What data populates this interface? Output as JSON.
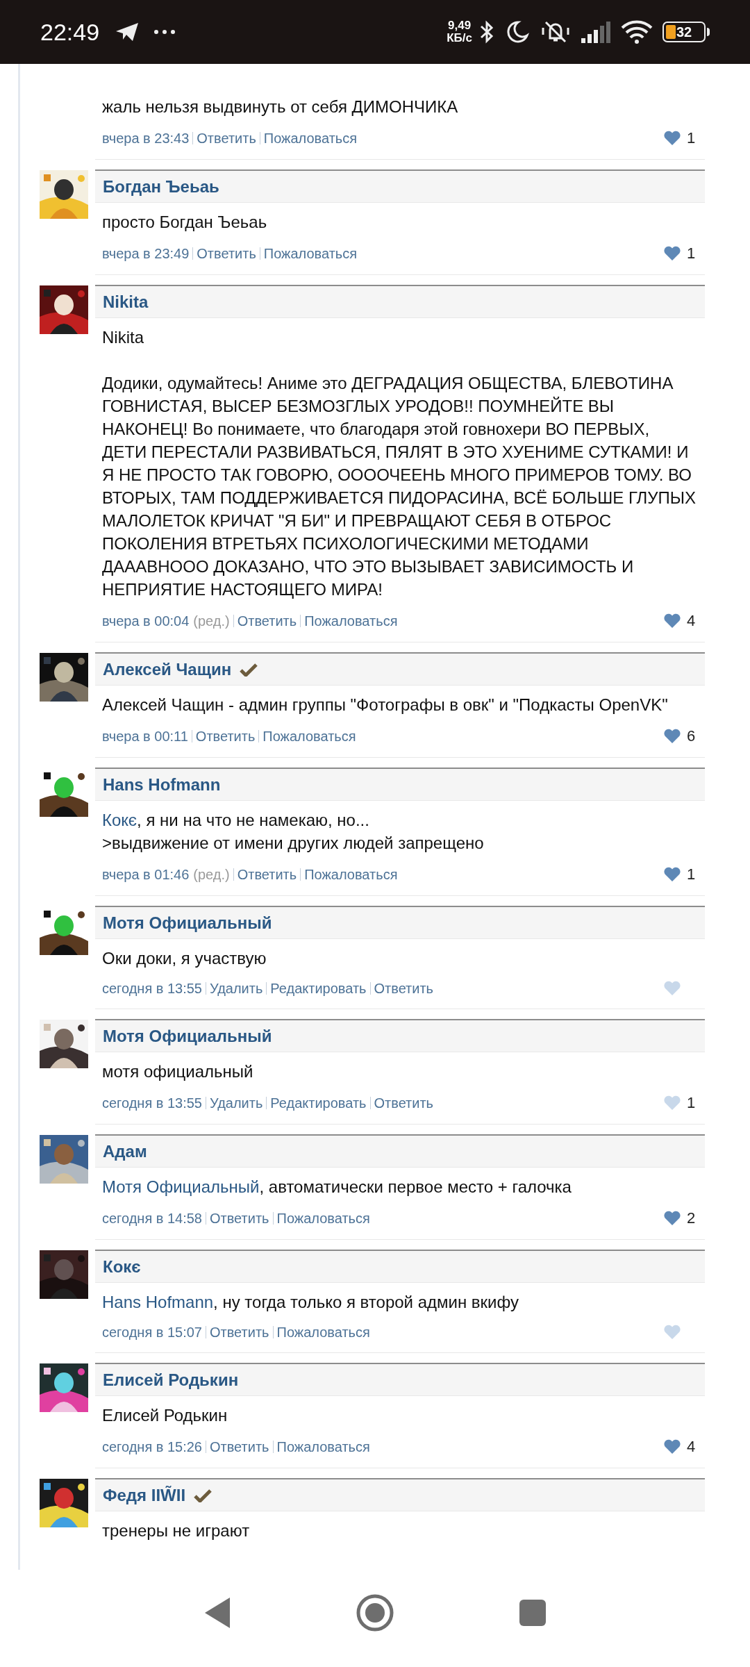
{
  "status_bar": {
    "time": "22:49",
    "speed_value": "9,49",
    "speed_unit": "КБ/с",
    "battery": "32"
  },
  "comments": [
    {
      "lines": [
        {
          "text": "жаль нельзя выдвинуть от себя ДИМОНЧИКА"
        }
      ],
      "meta": {
        "time": "вчера в 23:43",
        "edited": false,
        "actions": [
          "Ответить",
          "Пожаловаться"
        ],
        "liked": true,
        "likes": "1"
      }
    },
    {
      "author": {
        "name": "Богдан Ъеьаь",
        "verified": false
      },
      "avatar": {
        "kind": "picture"
      },
      "lines": [
        {
          "text": "просто Богдан Ъеьаь"
        }
      ],
      "meta": {
        "time": "вчера в 23:49",
        "edited": false,
        "actions": [
          "Ответить",
          "Пожаловаться"
        ],
        "liked": true,
        "likes": "1"
      }
    },
    {
      "author": {
        "name": "Nikita",
        "verified": false
      },
      "avatar": {
        "kind": "picture"
      },
      "paragraphs": [
        [
          {
            "text": "Nikita"
          }
        ],
        [
          {
            "text": "Додики, одумайтесь! Аниме это ДЕГРАДАЦИЯ ОБЩЕСТВА, БЛЕВОТИНА ГОВНИСТАЯ, ВЫСЕР БЕЗМОЗГЛЫХ УРОДОВ!! ПОУМНЕЙТЕ ВЫ НАКОНЕЦ! Во понимаете, что благодаря этой говнохери ВО ПЕРВЫХ, ДЕТИ ПЕРЕСТАЛИ РАЗВИВАТЬСЯ, ПЯЛЯТ В ЭТО ХУЕНИМЕ СУТКАМИ! И Я НЕ ПРОСТО ТАК ГОВОРЮ, ООООЧЕЕНЬ МНОГО ПРИМЕРОВ ТОМУ. ВО ВТОРЫХ, ТАМ ПОДДЕРЖИВАЕТСЯ ПИДОРАСИНА, ВСЁ БОЛЬШЕ ГЛУПЫХ МАЛОЛЕТОК КРИЧАТ \"Я БИ\" И ПРЕВРАЩАЮТ СЕБЯ В ОТБРОС ПОКОЛЕНИЯ ВТРЕТЬЯХ ПСИХОЛОГИЧЕСКИМИ МЕТОДАМИ ДАААВНООО ДОКАЗАНО, ЧТО ЭТО ВЫЗЫВАЕТ ЗАВИСИМОСТЬ И НЕПРИЯТИЕ НАСТОЯЩЕГО МИРА!"
          }
        ]
      ],
      "meta": {
        "time": "вчера в 00:04",
        "edited": true,
        "edited_label": "(ред.)",
        "actions": [
          "Ответить",
          "Пожаловаться"
        ],
        "liked": true,
        "likes": "4"
      }
    },
    {
      "author": {
        "name": "Алексей Чащин",
        "verified": true
      },
      "avatar": {
        "kind": "picture"
      },
      "lines": [
        {
          "text": "Алексей Чащин - админ группы \"Фотографы в овк\" и \"Подкасты OpenVK\""
        }
      ],
      "meta": {
        "time": "вчера в 00:11",
        "edited": false,
        "actions": [
          "Ответить",
          "Пожаловаться"
        ],
        "liked": true,
        "likes": "6"
      }
    },
    {
      "author": {
        "name": "Hans Hofmann",
        "verified": false
      },
      "avatar": {
        "kind": "picture"
      },
      "paragraphs": [
        [
          {
            "mention": "Кокє",
            "text": ", я ни на что не намекаю, но..."
          },
          {
            "text": ">выдвижение от имени других людей запрещено"
          }
        ]
      ],
      "meta": {
        "time": "вчера в 01:46",
        "edited": true,
        "edited_label": "(ред.)",
        "actions": [
          "Ответить",
          "Пожаловаться"
        ],
        "liked": true,
        "likes": "1"
      }
    },
    {
      "author": {
        "name": "Мотя Официальный",
        "verified": false
      },
      "avatar": {
        "kind": "picture"
      },
      "lines": [
        {
          "text": "Оки доки, я участвую"
        }
      ],
      "meta": {
        "time": "сегодня в 13:55",
        "edited": false,
        "actions": [
          "Удалить",
          "Редактировать",
          "Ответить"
        ],
        "liked": false
      }
    },
    {
      "author": {
        "name": "Мотя Официальный",
        "verified": false
      },
      "avatar": {
        "kind": "picture"
      },
      "lines": [
        {
          "text": "мотя официальный"
        }
      ],
      "meta": {
        "time": "сегодня в 13:55",
        "edited": false,
        "actions": [
          "Удалить",
          "Редактировать",
          "Ответить"
        ],
        "liked": false,
        "likes": "1"
      }
    },
    {
      "author": {
        "name": "Адам",
        "verified": false
      },
      "avatar": {
        "kind": "picture"
      },
      "lines": [
        {
          "mention": "Мотя Официальный",
          "text": ", автоматически первое место + галочка"
        }
      ],
      "meta": {
        "time": "сегодня в 14:58",
        "edited": false,
        "actions": [
          "Ответить",
          "Пожаловаться"
        ],
        "liked": true,
        "likes": "2"
      }
    },
    {
      "author": {
        "name": "Кокє",
        "verified": false
      },
      "avatar": {
        "kind": "picture"
      },
      "lines": [
        {
          "mention": "Hans Hofmann",
          "text": ", ну тогда только я второй админ вкифу"
        }
      ],
      "meta": {
        "time": "сегодня в 15:07",
        "edited": false,
        "actions": [
          "Ответить",
          "Пожаловаться"
        ],
        "liked": false
      }
    },
    {
      "author": {
        "name": "Елисей Родькин",
        "verified": false
      },
      "avatar": {
        "kind": "picture"
      },
      "lines": [
        {
          "text": "Елисей Родькин"
        }
      ],
      "meta": {
        "time": "сегодня в 15:26",
        "edited": false,
        "actions": [
          "Ответить",
          "Пожаловаться"
        ],
        "liked": true,
        "likes": "4"
      }
    },
    {
      "author": {
        "name": "Федя IIW̃II",
        "verified": true
      },
      "avatar": {
        "kind": "picture"
      },
      "lines": [
        {
          "text": "тренеры не играют"
        }
      ]
    }
  ]
}
